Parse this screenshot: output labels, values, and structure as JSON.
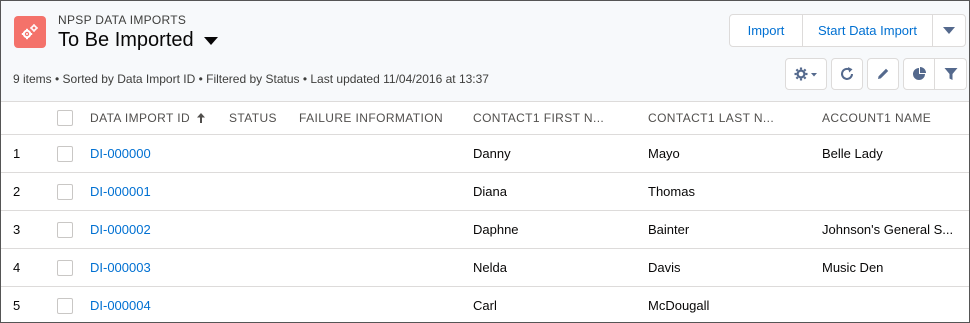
{
  "header": {
    "object_label": "NPSP DATA IMPORTS",
    "list_title": "To Be Imported",
    "subtitle": "9 items • Sorted by Data Import ID • Filtered by Status • Last updated 11/04/2016 at 13:37",
    "app_icon": "gears-icon",
    "accent_color": "#f4726a"
  },
  "actions": {
    "import_label": "Import",
    "start_label": "Start Data Import",
    "more_icon": "chevron-down-icon"
  },
  "toolbar_icons": [
    "gear-icon",
    "refresh-icon",
    "edit-icon",
    "pie-chart-icon",
    "filter-icon"
  ],
  "table": {
    "columns": {
      "id": "DATA IMPORT ID",
      "status": "STATUS",
      "failure": "FAILURE INFORMATION",
      "first": "CONTACT1 FIRST N...",
      "last": "CONTACT1 LAST N...",
      "account": "ACCOUNT1 NAME"
    },
    "sort_icon": "arrow-up-icon",
    "rows": [
      {
        "num": "1",
        "id": "DI-000000",
        "status": "",
        "failure": "",
        "first": "Danny",
        "last": "Mayo",
        "account": "Belle Lady"
      },
      {
        "num": "2",
        "id": "DI-000001",
        "status": "",
        "failure": "",
        "first": "Diana",
        "last": "Thomas",
        "account": ""
      },
      {
        "num": "3",
        "id": "DI-000002",
        "status": "",
        "failure": "",
        "first": "Daphne",
        "last": "Bainter",
        "account": "Johnson's General S..."
      },
      {
        "num": "4",
        "id": "DI-000003",
        "status": "",
        "failure": "",
        "first": "Nelda",
        "last": "Davis",
        "account": "Music Den"
      },
      {
        "num": "5",
        "id": "DI-000004",
        "status": "",
        "failure": "",
        "first": "Carl",
        "last": "McDougall",
        "account": ""
      }
    ]
  }
}
